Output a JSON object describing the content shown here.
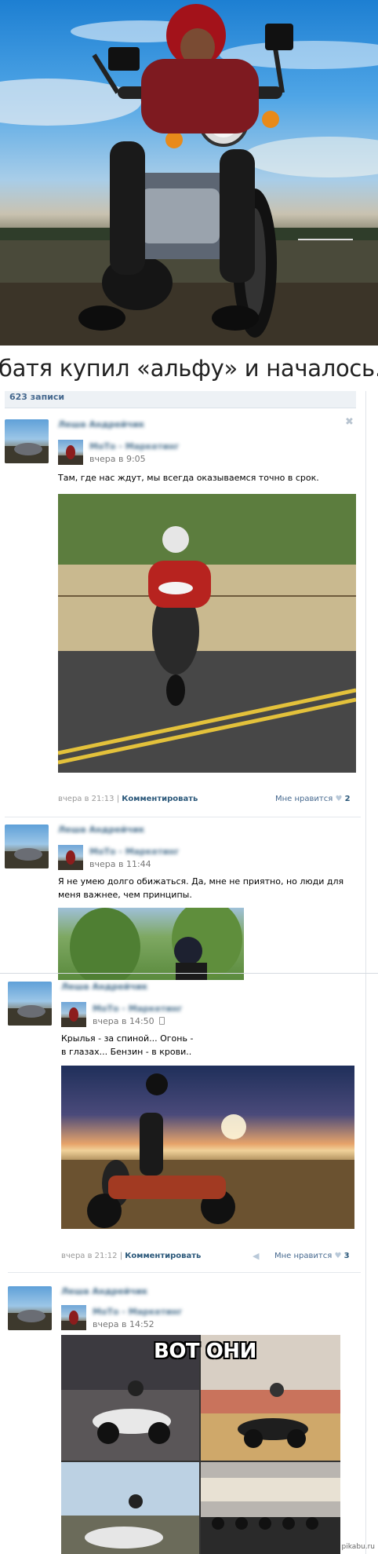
{
  "hero": {
    "caption": "батя купил «альфу» и началось..."
  },
  "wall": {
    "count": "623 записи",
    "close_glyph": "✖",
    "posts": [
      {
        "author": "Леша Андрейчик",
        "repost_source": "МоТо - Маркетинг",
        "time": "вчера в 9:05",
        "text": "Там, где нас ждут, мы всегда оказываемся точно в срок.",
        "footer_time": "вчера в 21:13",
        "comment_label": "Комментировать",
        "like_label": "Мне нравится",
        "like_count": "2"
      },
      {
        "author": "Леша Андрейчик",
        "repost_source": "МоТо - Маркетинг",
        "time": "вчера в 11:44",
        "text_line1": "Я не умею долго обижаться. Да, мне не приятно, но люди для",
        "text_line2": "меня важнее, чем принципы."
      },
      {
        "author": "Леша Андрейчик",
        "repost_source": "МоТо - Маркетинг",
        "time": "вчера в 14:50",
        "text_line1": "Крылья - за спиной... Огонь -",
        "text_line2": "в глазах... Бензин - в крови..",
        "footer_time": "вчера в 21:12",
        "comment_label": "Комментировать",
        "like_label": "Мне нравится",
        "like_count": "3"
      },
      {
        "author": "Леша Андрейчик",
        "repost_source": "МоТо - Маркетинг",
        "time": "вчера в 14:52",
        "meme_text": "ВОТ ОНИ"
      }
    ]
  },
  "watermark": "pikabu.ru",
  "icons": {
    "heart": "heart-icon",
    "share": "megaphone-icon",
    "close": "close-icon",
    "phone": "mobile-icon"
  },
  "colors": {
    "link": "#2b587a",
    "muted": "#999999",
    "count_bar": "#edf1f5"
  }
}
